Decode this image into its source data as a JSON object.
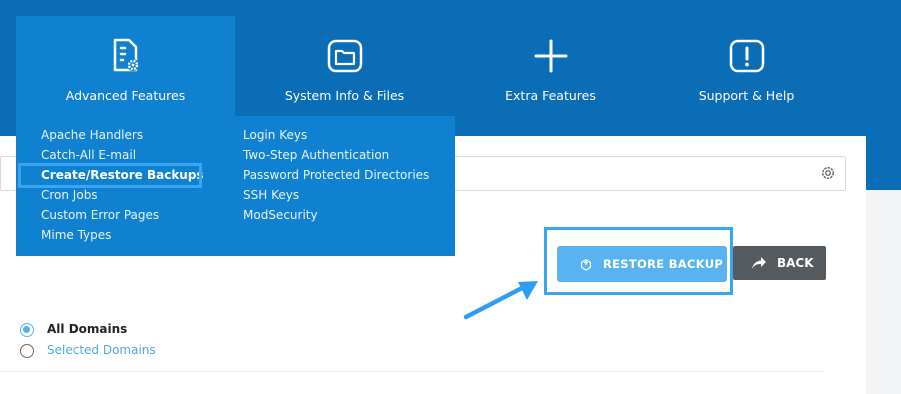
{
  "nav": {
    "items": [
      {
        "label": "Advanced Features",
        "icon": "file-gear-icon",
        "active": true
      },
      {
        "label": "System Info & Files",
        "icon": "folder-icon",
        "active": false
      },
      {
        "label": "Extra Features",
        "icon": "plus-icon",
        "active": false
      },
      {
        "label": "Support & Help",
        "icon": "alert-icon",
        "active": false
      }
    ]
  },
  "dropdown": {
    "col1": [
      "Apache Handlers",
      "Catch-All E-mail",
      "Create/Restore Backups",
      "Cron Jobs",
      "Custom Error Pages",
      "Mime Types"
    ],
    "col2": [
      "Login Keys",
      "Two-Step Authentication",
      "Password Protected Directories",
      "SSH Keys",
      "ModSecurity"
    ],
    "highlighted": "Create/Restore Backups"
  },
  "search": {
    "icon": "gear-icon"
  },
  "actions": {
    "restore_label": "RESTORE BACKUP",
    "back_label": "BACK"
  },
  "domains": {
    "options": [
      "All Domains",
      "Selected Domains"
    ],
    "selected": "All Domains"
  },
  "colors": {
    "nav_bg": "#0a6db5",
    "nav_active": "#1081d0",
    "highlight": "#3aa5f2",
    "restore_btn": "#59b3f0",
    "back_btn": "#555a5f"
  }
}
